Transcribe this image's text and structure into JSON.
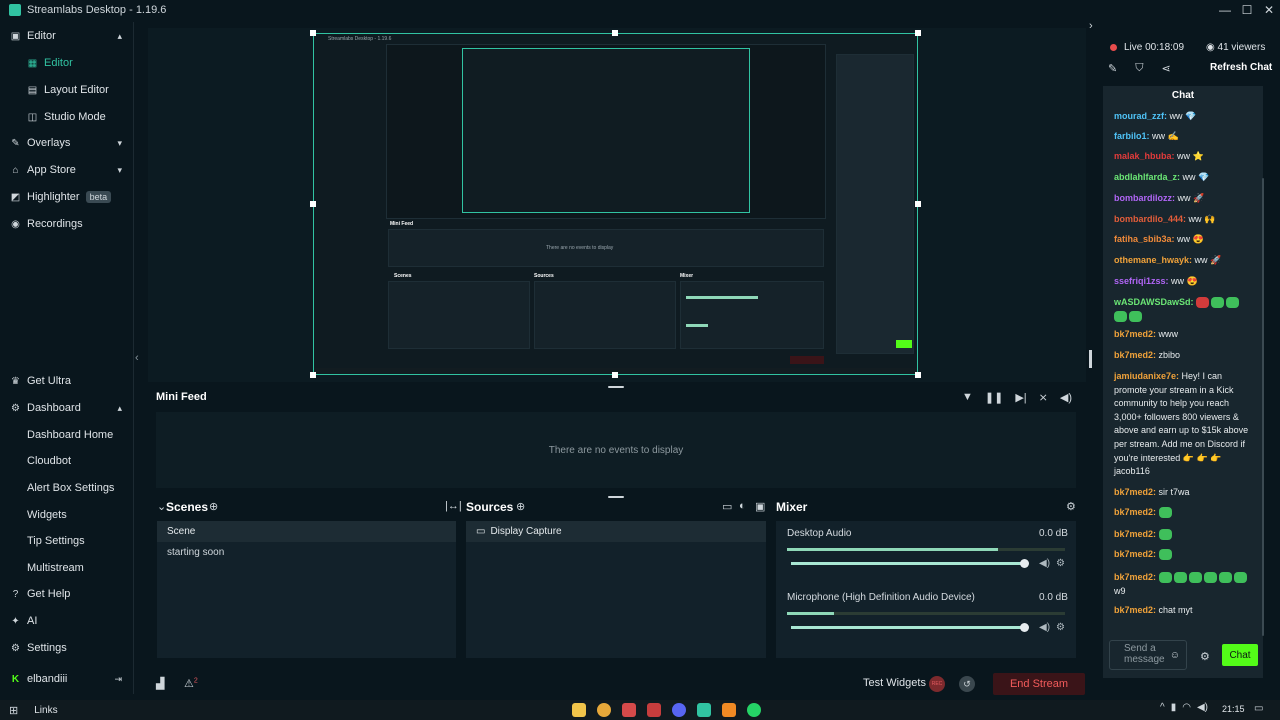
{
  "window": {
    "title": "Streamlabs Desktop - 1.19.6",
    "controls": [
      "—",
      "☐",
      "✕"
    ]
  },
  "sidebar": {
    "items": [
      {
        "label": "Editor",
        "icon": "editor-icon",
        "chevron": "▴"
      },
      {
        "label": "Editor",
        "icon": "editor-grid-icon",
        "active": true
      },
      {
        "label": "Layout Editor",
        "icon": "layout-icon"
      },
      {
        "label": "Studio Mode",
        "icon": "studio-mode-icon"
      },
      {
        "label": "Overlays",
        "icon": "overlays-icon",
        "chevron": "▾"
      },
      {
        "label": "App Store",
        "icon": "app-store-icon",
        "chevron": "▾"
      },
      {
        "label": "Highlighter",
        "icon": "highlighter-icon",
        "badge": "beta"
      },
      {
        "label": "Recordings",
        "icon": "recordings-icon"
      },
      {
        "label": "Get Ultra",
        "icon": "ultra-icon"
      },
      {
        "label": "Dashboard",
        "icon": "dashboard-icon",
        "chevron": "▴"
      },
      {
        "label": "Dashboard Home"
      },
      {
        "label": "Cloudbot"
      },
      {
        "label": "Alert Box Settings"
      },
      {
        "label": "Widgets"
      },
      {
        "label": "Tip Settings"
      },
      {
        "label": "Multistream"
      },
      {
        "label": "Get Help",
        "icon": "help-icon"
      },
      {
        "label": "AI",
        "icon": "ai-icon"
      },
      {
        "label": "Settings",
        "icon": "settings-icon"
      },
      {
        "label": "elbandiii",
        "icon": "kick-icon",
        "trail": "⇥"
      }
    ],
    "collapse": "‹"
  },
  "editor": {
    "nested_title": "Streamlabs Desktop - 1.19.6",
    "nested_minifeed": "Mini Feed",
    "nested_empty": "There are no events to display",
    "nested_scenes": "Scenes",
    "nested_sources": "Sources",
    "nested_mixer": "Mixer"
  },
  "minifeed": {
    "title": "Mini Feed",
    "empty": "There are no events to display",
    "tools": [
      "filter-icon",
      "pause-icon",
      "skip-icon",
      "mute-alerts-icon",
      "volume-icon"
    ]
  },
  "scenes": {
    "title": "Scenes",
    "header": "Scene",
    "items": [
      "starting soon"
    ]
  },
  "sources": {
    "title": "Sources",
    "items": [
      "Display Capture"
    ]
  },
  "mixer": {
    "title": "Mixer",
    "channels": [
      {
        "name": "Desktop Audio",
        "db": "0.0 dB",
        "level": 0.76,
        "volume": 1.0
      },
      {
        "name": "Microphone (High Definition Audio Device)",
        "db": "0.0 dB",
        "level": 0.17,
        "volume": 1.0
      }
    ]
  },
  "footer": {
    "test_widgets": "Test Widgets",
    "rec_label": "REC",
    "end_stream": "End Stream",
    "alert_count": "2"
  },
  "chat_panel": {
    "live": "Live 00:18:09",
    "viewers": "41 viewers",
    "refresh": "Refresh Chat",
    "header": "Chat",
    "messages": [
      {
        "user": "mourad_zzf:",
        "text": "ww 💎",
        "color": "#4fc3f7"
      },
      {
        "user": "farbilo1:",
        "text": "ww ✍",
        "color": "#4fc3f7"
      },
      {
        "user": "malak_hbuba:",
        "text": "ww ⭐",
        "color": "#e23b3b"
      },
      {
        "user": "abdlahlfarda_z:",
        "text": "ww 💎",
        "color": "#6be675"
      },
      {
        "user": "bombardilozz:",
        "text": "ww 🚀",
        "color": "#b065f5"
      },
      {
        "user": "bombardilo_444:",
        "text": "ww 🙌",
        "color": "#e25d3a"
      },
      {
        "user": "fatiha_sbib3a:",
        "text": "ww 😍",
        "color": "#f08a3a"
      },
      {
        "user": "othemane_hwayk:",
        "text": "ww 🚀",
        "color": "#f0a23a"
      },
      {
        "user": "ssefriqi1zss:",
        "text": "ww 😍",
        "color": "#b065f5"
      },
      {
        "user": "wASDAWSDawSd:",
        "text": "",
        "color": "#6be675"
      },
      {
        "user": "bk7med2:",
        "text": "www",
        "color": "#f0a23a"
      },
      {
        "user": "bk7med2:",
        "text": "zbibo",
        "color": "#f0a23a"
      },
      {
        "user": "jamiudanixe7e:",
        "text": "Hey! I can promote your stream in a Kick community to help you reach 3,000+ followers 800 viewers & above and earn up to $15k above per stream. Add me on Discord if you're interested 👉 👉 👉 jacob116",
        "color": "#f0a23a"
      },
      {
        "user": "bk7med2:",
        "text": "sir t7wa",
        "color": "#f0a23a"
      },
      {
        "user": "bk7med2:",
        "text": "",
        "color": "#f0a23a"
      },
      {
        "user": "bk7med2:",
        "text": "",
        "color": "#f0a23a"
      },
      {
        "user": "bk7med2:",
        "text": "",
        "color": "#f0a23a"
      },
      {
        "user": "bk7med2:",
        "text": "w9",
        "color": "#f0a23a"
      },
      {
        "user": "bk7med2:",
        "text": "chat myt",
        "color": "#f0a23a"
      }
    ],
    "send_placeholder": "Send a message",
    "chat_button": "Chat"
  },
  "taskbar": {
    "links": "Links",
    "clock": "21:15",
    "apps": [
      "explorer",
      "chrome",
      "capcut",
      "app-red",
      "discord",
      "kick",
      "vlc",
      "whatsapp"
    ]
  },
  "colors": {
    "accent": "#31c3a2",
    "kick_green": "#53fc18",
    "end_stream": "#f25b5b"
  }
}
